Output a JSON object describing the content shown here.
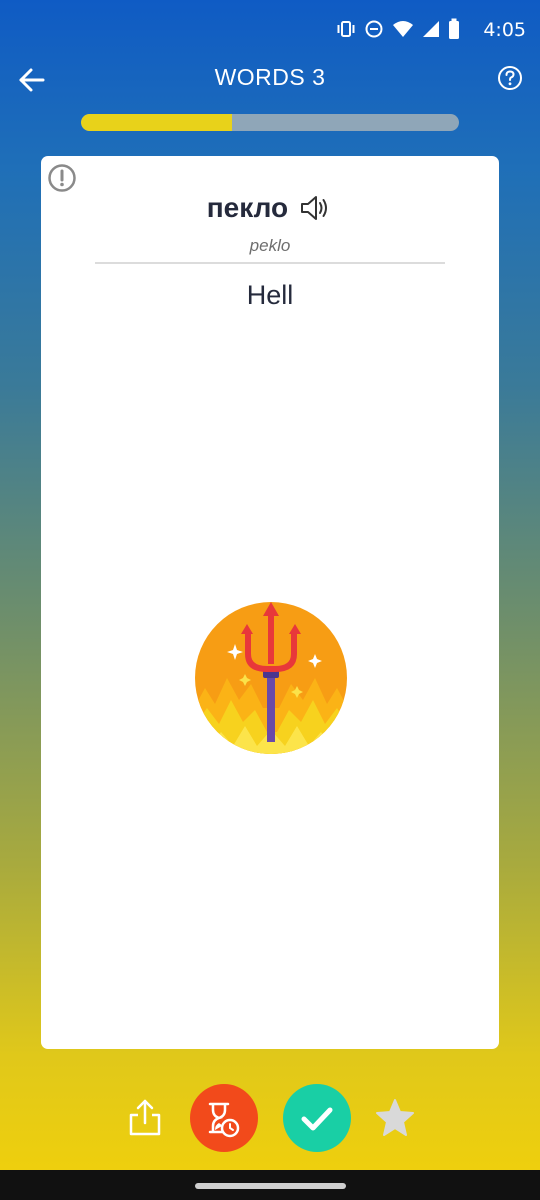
{
  "status_bar": {
    "time": "4:05",
    "icons": [
      "vibrate-icon",
      "do-not-disturb-icon",
      "wifi-icon",
      "signal-icon",
      "battery-icon"
    ]
  },
  "header": {
    "title": "WORDS 3",
    "back_icon": "arrow-left-icon",
    "help_icon": "question-mark-icon"
  },
  "progress": {
    "value": 0.4,
    "fill_color": "#e8d21a",
    "track_color": "#8fa6b8"
  },
  "card": {
    "report_icon": "exclamation-icon",
    "word": "пекло",
    "speaker_icon": "speaker-icon",
    "transliteration": "peklo",
    "translation": "Hell",
    "image_icon": "devil-trident-flames-icon"
  },
  "actions": {
    "share_icon": "share-icon",
    "later_icon": "hourglass-clock-icon",
    "later_color": "#f24a1b",
    "know_icon": "checkmark-icon",
    "know_color": "#19cfa5",
    "favorite_icon": "star-icon"
  }
}
